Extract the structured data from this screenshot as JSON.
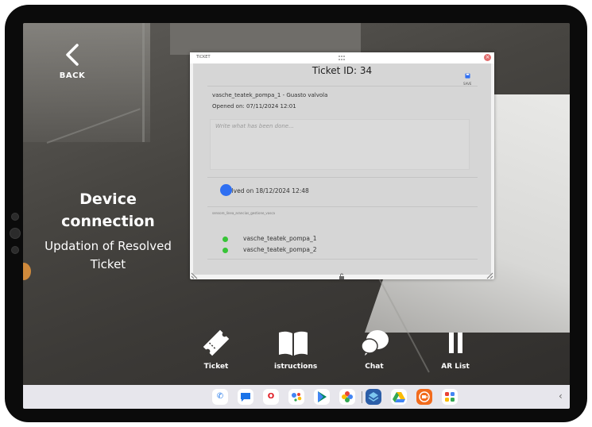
{
  "nav": {
    "back_label": "BACK"
  },
  "info_panel": {
    "title": "Device connection",
    "subtitle": "Updation of Resolved Ticket"
  },
  "ticket_window": {
    "header_label": "TICKET",
    "close_label": "×",
    "title": "Ticket ID: 34",
    "save_label": "SAVE",
    "info_line": "vasche_teatek_pompa_1 - Guasto valvola",
    "opened_on": "Opened on: 07/11/2024 12:01",
    "notes_placeholder": "Write what has been done...",
    "resolved_text": "olved on 18/12/2024 12:48",
    "devices_label": "sensore_linea_arancias_gestione_vasca",
    "devices": [
      {
        "name": "vasche_teatek_pompa_1",
        "status_color": "#37c437"
      },
      {
        "name": "vasche_teatek_pompa_2",
        "status_color": "#37c437"
      }
    ]
  },
  "toolbar": {
    "ticket_label": "Ticket",
    "instructions_label": "istructions",
    "chat_label": "Chat",
    "ar_list_label": "AR List"
  },
  "dock": {
    "apps": [
      "phone",
      "messages",
      "opera",
      "assistant",
      "play-store",
      "photos",
      "app-stack",
      "drive",
      "camera-recorder",
      "apps-grid"
    ],
    "chevron": "‹"
  },
  "colors": {
    "accent_blue": "#2f6ff2",
    "status_green": "#37c437",
    "close_red": "#e06d6d"
  }
}
